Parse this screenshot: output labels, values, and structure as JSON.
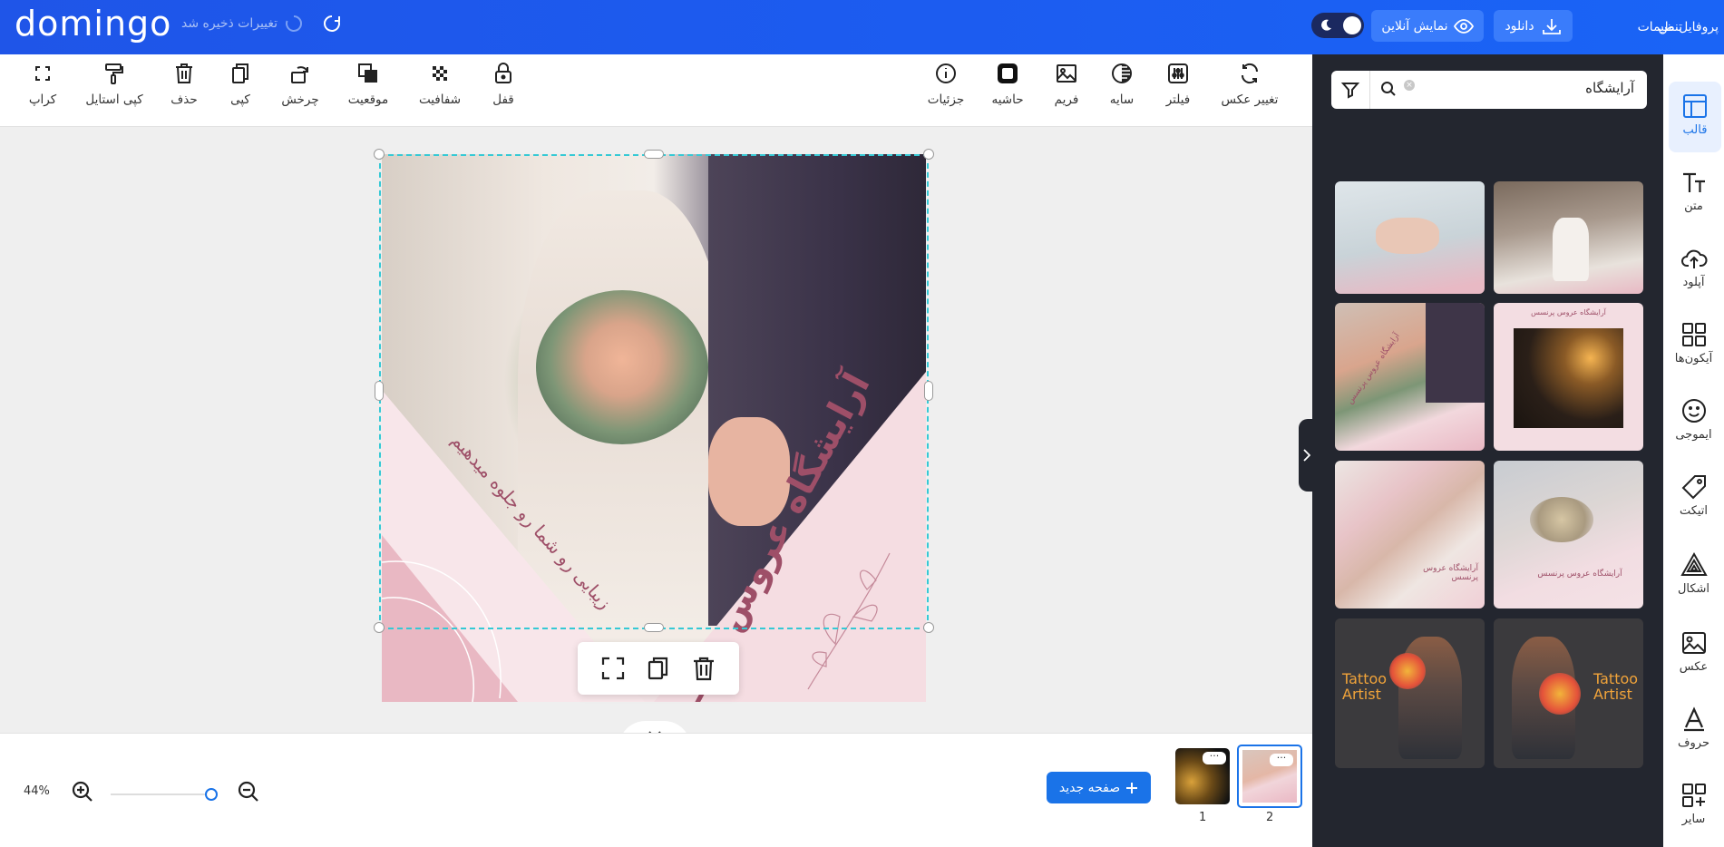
{
  "header": {
    "logo": "domingo",
    "save_status": "تغییرات ذخیره شد",
    "nav": {
      "profile": "پروفایل من",
      "settings": "تنظیمات"
    },
    "download_label": "دانلود",
    "preview_label": "نمایش آنلاین"
  },
  "toolbar": {
    "left_tools": [
      {
        "label": "کراپ",
        "icon": "crop-icon"
      },
      {
        "label": "کپی استایل",
        "icon": "paint-roller-icon"
      },
      {
        "label": "حذف",
        "icon": "trash-icon"
      },
      {
        "label": "کپی",
        "icon": "copy-icon"
      },
      {
        "label": "چرخش",
        "icon": "rotate-icon"
      },
      {
        "label": "موقعیت",
        "icon": "layers-icon"
      },
      {
        "label": "شفافیت",
        "icon": "checkerboard-icon"
      },
      {
        "label": "قفل",
        "icon": "lock-icon"
      }
    ],
    "right_tools": [
      {
        "label": "جزئیات",
        "icon": "info-icon"
      },
      {
        "label": "حاشیه",
        "icon": "border-icon"
      },
      {
        "label": "فریم",
        "icon": "image-frame-icon"
      },
      {
        "label": "سایه",
        "icon": "contrast-icon"
      },
      {
        "label": "فیلتر",
        "icon": "sliders-icon"
      },
      {
        "label": "تغییر عکس",
        "icon": "refresh-icon"
      }
    ]
  },
  "design": {
    "title": "آرایشگاه عروس پرنـــسس",
    "subtitle": "زیبایی رو شما رو جلوه میدهیم"
  },
  "bottom": {
    "zoom": "44%",
    "new_page_label": "صفحه جدید",
    "pages": [
      {
        "number": "1"
      },
      {
        "number": "2"
      }
    ]
  },
  "panel": {
    "search_query": "آرایشگاه",
    "templates": [
      {
        "title": "",
        "subtitle": ""
      },
      {
        "title": "",
        "subtitle": ""
      },
      {
        "title": "آرایشگاه عروس پرنسس",
        "subtitle": ""
      },
      {
        "title": "آرایشگاه عروس پرنسس",
        "subtitle": ""
      },
      {
        "title": "آرایشگاه عروس پرنسس",
        "subtitle": ""
      },
      {
        "title": "آرایشگاه عروس پرنسس",
        "subtitle": ""
      },
      {
        "title": "Tattoo Artist",
        "subtitle": ""
      },
      {
        "title": "Tattoo Artist",
        "subtitle": ""
      }
    ]
  },
  "sidebar": {
    "items": [
      {
        "label": "قالب",
        "icon": "template-icon"
      },
      {
        "label": "متن",
        "icon": "text-icon"
      },
      {
        "label": "آپلود",
        "icon": "upload-cloud-icon"
      },
      {
        "label": "آیکون‌ها",
        "icon": "grid-icon"
      },
      {
        "label": "ایموجی",
        "icon": "smiley-icon"
      },
      {
        "label": "اتیکت",
        "icon": "tag-icon"
      },
      {
        "label": "اشکال",
        "icon": "shapes-icon"
      },
      {
        "label": "عکس",
        "icon": "photo-icon"
      },
      {
        "label": "حروف",
        "icon": "letter-a-icon"
      },
      {
        "label": "سایر",
        "icon": "add-grid-icon"
      }
    ]
  },
  "colors": {
    "header_blue": "#1c5cf0",
    "button_blue": "#1a73e8",
    "panel_dark": "#23262f",
    "selection_cyan": "#35c9d5",
    "design_accent": "#9e4f68"
  }
}
